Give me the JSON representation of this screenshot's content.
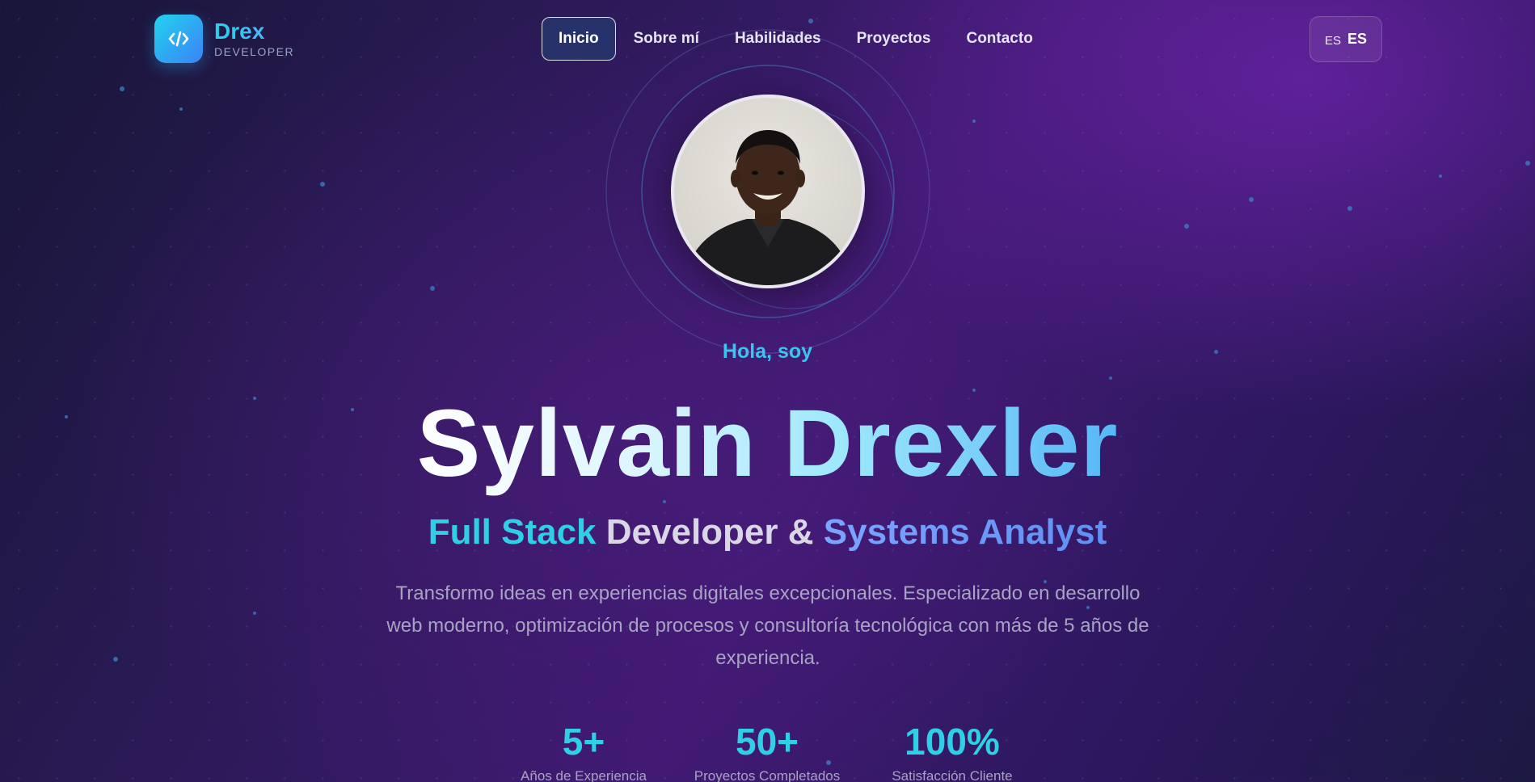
{
  "nav": {
    "brand": {
      "name": "Drex",
      "subtitle": "DEVELOPER",
      "icon": "code-icon"
    },
    "items": [
      {
        "label": "Inicio",
        "active": true
      },
      {
        "label": "Sobre mí",
        "active": false
      },
      {
        "label": "Habilidades",
        "active": false
      },
      {
        "label": "Proyectos",
        "active": false
      },
      {
        "label": "Contacto",
        "active": false
      }
    ],
    "language": {
      "flag": "ES",
      "code": "ES"
    }
  },
  "hero": {
    "avatar_alt": "profile-photo",
    "greeting": "Hola, soy",
    "name": "Sylvain Drexler",
    "role": {
      "part1": "Full Stack",
      "part2": " Developer & ",
      "part3": "Systems Analyst"
    },
    "description": "Transformo ideas en experiencias digitales excepcionales. Especializado en desarrollo web moderno, optimización de procesos y consultoría tecnológica con más de 5 años de experiencia.",
    "stats": [
      {
        "value": "5+",
        "label": "Años de Experiencia"
      },
      {
        "value": "50+",
        "label": "Proyectos Completados"
      },
      {
        "value": "100%",
        "label": "Satisfacción Cliente"
      }
    ]
  },
  "colors": {
    "accent_cyan": "#2fd0e6",
    "accent_blue": "#5f8ff5",
    "background": "#3f1a72"
  }
}
